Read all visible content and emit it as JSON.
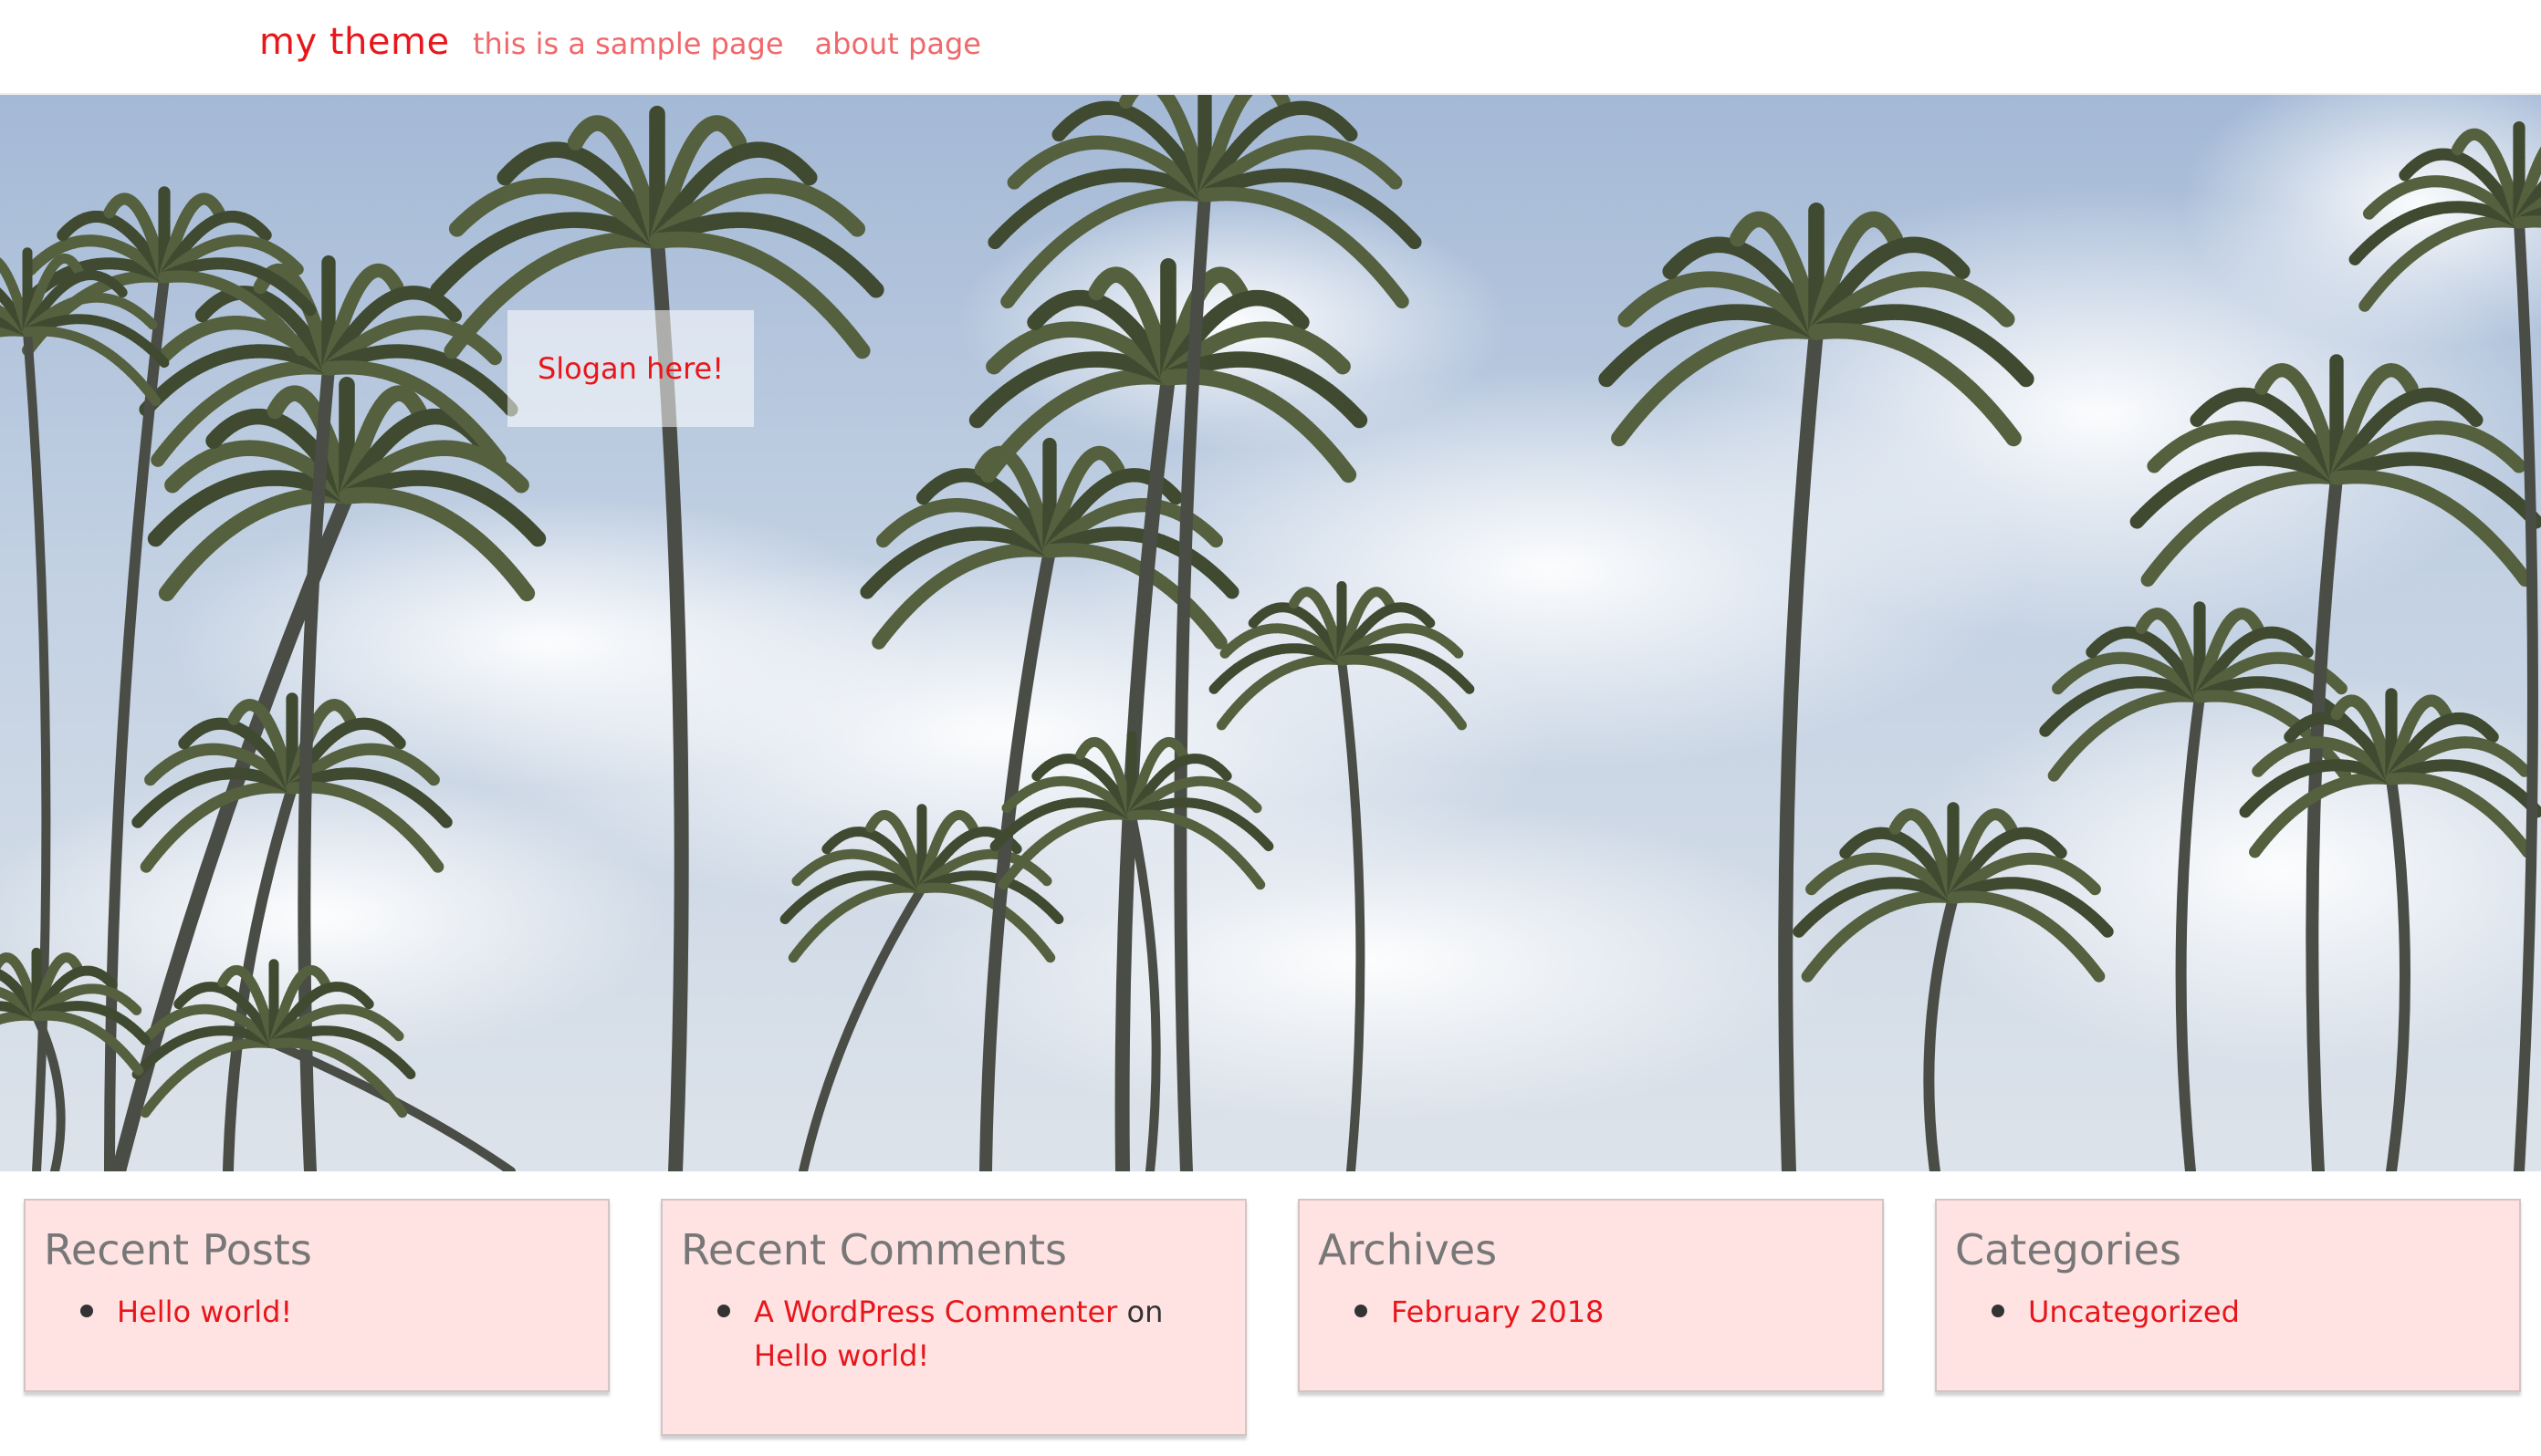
{
  "nav": {
    "brand": "my theme",
    "links": [
      "this is a sample page",
      "about page"
    ]
  },
  "hero": {
    "slogan": "Slogan here!"
  },
  "widgets": {
    "recent_posts": {
      "title": "Recent Posts",
      "items": [
        "Hello world!"
      ]
    },
    "recent_comments": {
      "title": "Recent Comments",
      "author": "A WordPress Commenter",
      "connector": "on",
      "post": "Hello world!"
    },
    "archives": {
      "title": "Archives",
      "items": [
        "February 2018"
      ]
    },
    "categories": {
      "title": "Categories",
      "items": [
        "Uncategorized"
      ]
    }
  },
  "colors": {
    "accent": "#e8161b",
    "nav_link": "#f0686b",
    "widget_bg": "#ffe3e3",
    "widget_title": "#777777"
  }
}
